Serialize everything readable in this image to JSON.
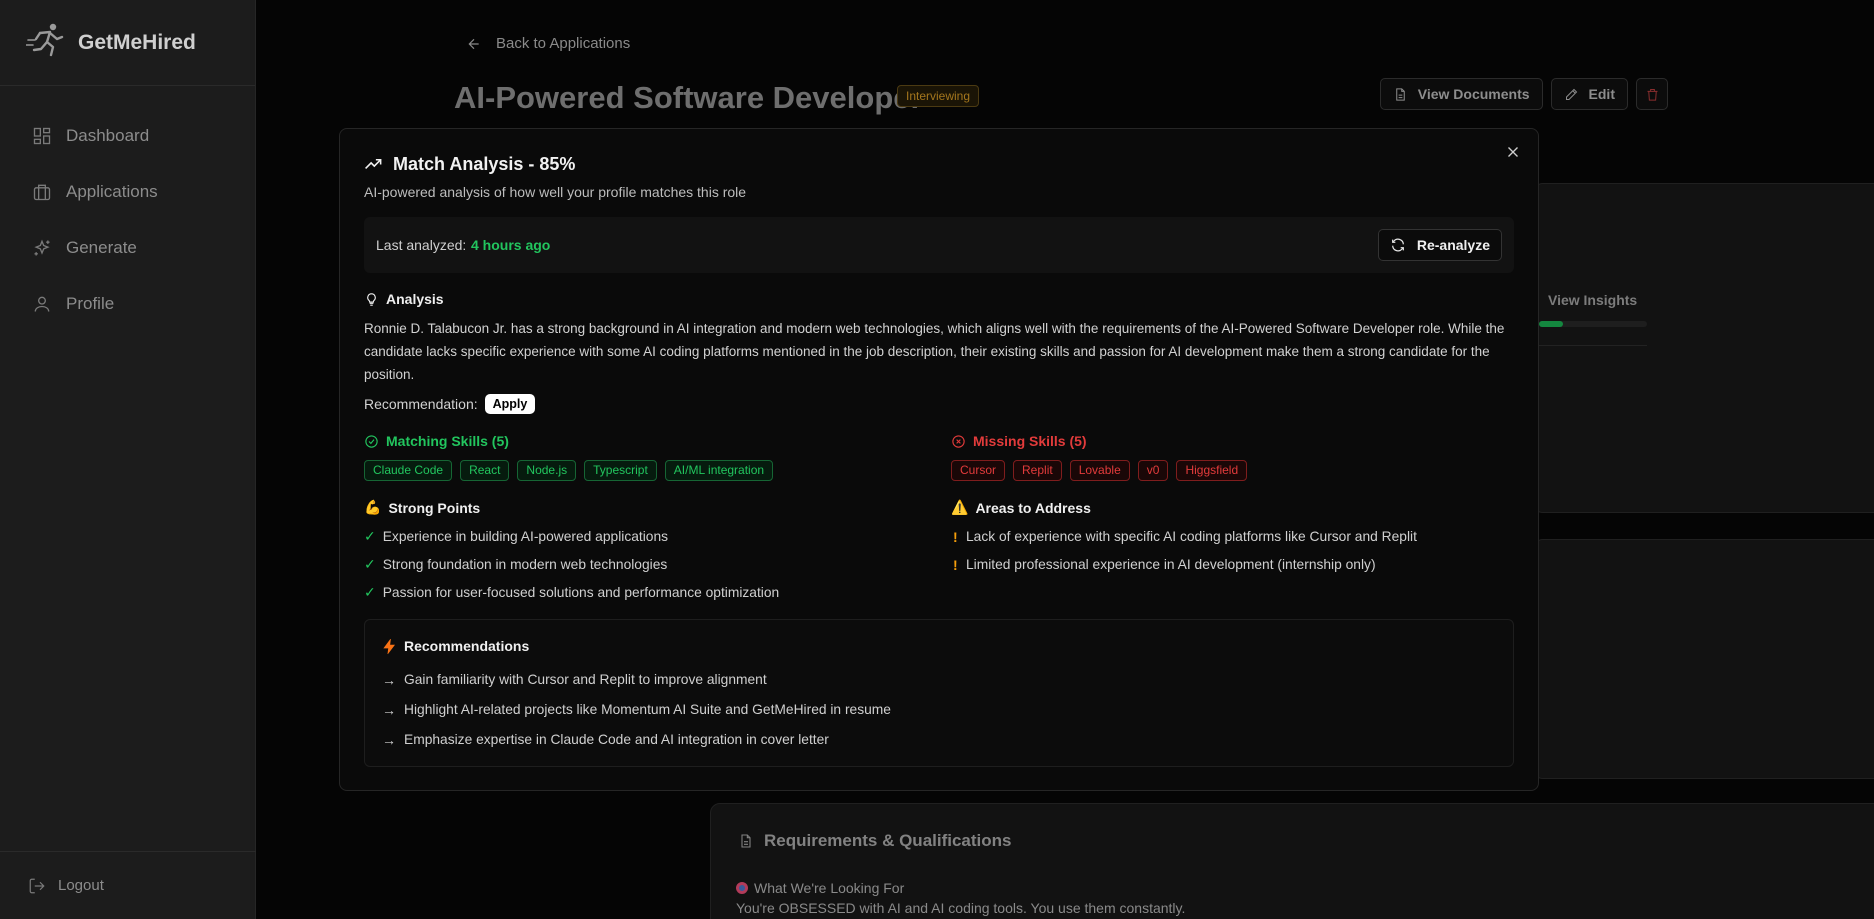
{
  "app": {
    "name": "GetMeHired"
  },
  "sidebar": {
    "items": [
      {
        "label": "Dashboard",
        "icon": "dashboard-icon"
      },
      {
        "label": "Applications",
        "icon": "briefcase-icon"
      },
      {
        "label": "Generate",
        "icon": "sparkles-icon"
      },
      {
        "label": "Profile",
        "icon": "user-icon"
      }
    ],
    "logout_label": "Logout"
  },
  "page": {
    "back_label": "Back to Applications",
    "title": "AI-Powered Software Developer",
    "status": "Interviewing",
    "actions": {
      "view_documents": "View Documents",
      "edit": "Edit"
    },
    "view_insights": "View Insights",
    "insights_progress": 0.22,
    "requirements": {
      "title": "Requirements & Qualifications",
      "subtitle": "What We're Looking For",
      "text": "You're OBSESSED with AI and AI coding tools. You use them constantly."
    }
  },
  "modal": {
    "title": "Match Analysis - 85%",
    "description": "AI-powered analysis of how well your profile matches this role",
    "last_analyzed_label": "Last analyzed:",
    "last_analyzed_value": "4 hours ago",
    "reanalyze_label": "Re-analyze",
    "analysis_heading": "Analysis",
    "analysis_text": "Ronnie D. Talabucon Jr. has a strong background in AI integration and modern web technologies, which aligns well with the requirements of the AI-Powered Software Developer role. While the candidate lacks specific experience with some AI coding platforms mentioned in the job description, their existing skills and passion for AI development make them a strong candidate for the position.",
    "recommendation_label": "Recommendation:",
    "recommendation_value": "Apply",
    "matching_heading": "Matching Skills (5)",
    "matching_skills": [
      "Claude Code",
      "React",
      "Node.js",
      "Typescript",
      "AI/ML integration"
    ],
    "missing_heading": "Missing Skills (5)",
    "missing_skills": [
      "Cursor",
      "Replit",
      "Lovable",
      "v0",
      "Higgsfield"
    ],
    "strong_heading": "Strong Points",
    "strong_emoji": "💪",
    "strong_points": [
      "Experience in building AI-powered applications",
      "Strong foundation in modern web technologies",
      "Passion for user-focused solutions and performance optimization"
    ],
    "areas_heading": "Areas to Address",
    "areas_emoji": "⚠️",
    "areas": [
      "Lack of experience with specific AI coding platforms like Cursor and Replit",
      "Limited professional experience in AI development (internship only)"
    ],
    "recommendations_heading": "Recommendations",
    "recommendations": [
      "Gain familiarity with Cursor and Replit to improve alignment",
      "Highlight AI-related projects like Momentum AI Suite and GetMeHired in resume",
      "Emphasize expertise in Claude Code and AI integration in cover letter"
    ]
  },
  "colors": {
    "accent_green": "#22c55e",
    "accent_red": "#e23b3b",
    "warning": "#f59e0b"
  }
}
